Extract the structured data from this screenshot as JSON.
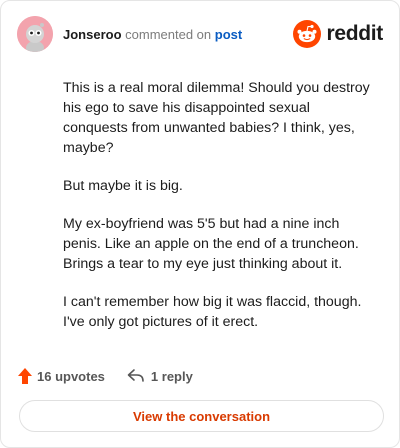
{
  "comment": {
    "username": "Jonseroo",
    "action_text": "commented on",
    "post_link": "post"
  },
  "brand": {
    "wordmark": "reddit",
    "color": "#ff4500"
  },
  "body": {
    "paragraphs": [
      "This is a real moral dilemma! Should you destroy his ego to save his disappointed sexual conquests from unwanted babies? I think, yes, maybe?",
      "But maybe it is big.",
      "My ex-boyfriend was 5'5 but had a nine inch penis. Like an apple on the end of a truncheon. Brings a tear to my eye just thinking about it.",
      "I can't remember how big it was flaccid, though. I've only got pictures of it erect."
    ]
  },
  "actions": {
    "upvotes": "16 upvotes",
    "replies": "1 reply",
    "upvote_color": "#ff4500"
  },
  "cta": {
    "label": "View the conversation"
  }
}
